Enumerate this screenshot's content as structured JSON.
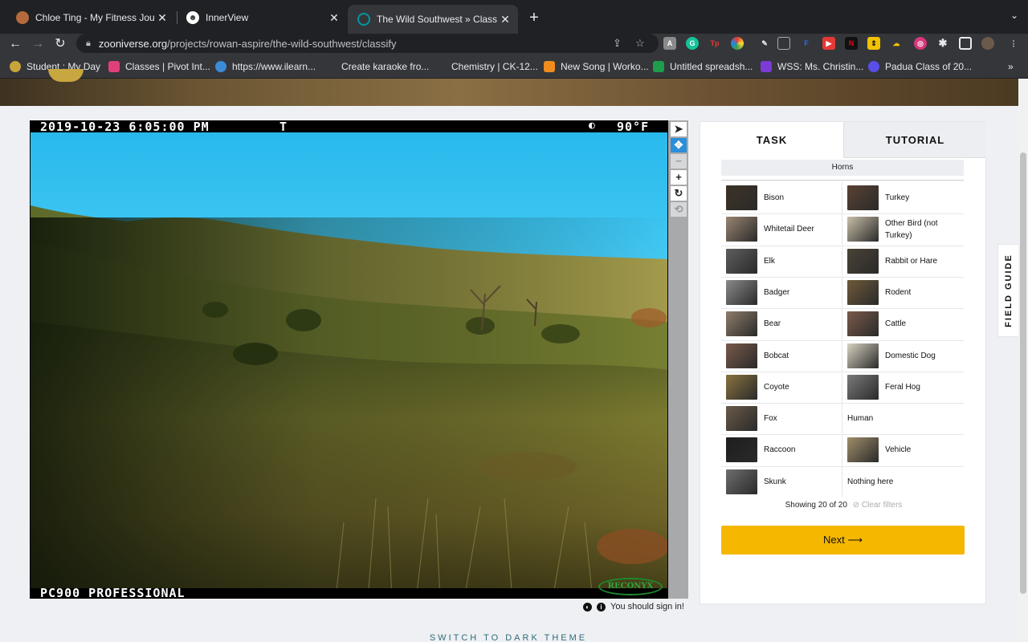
{
  "browser": {
    "tabs": [
      {
        "title": "Chloe Ting - My Fitness Journe",
        "icon": "chloe-ting-favicon",
        "color": "#b56a3c"
      },
      {
        "title": "InnerView",
        "icon": "innerview-favicon",
        "color": "#ffffff"
      },
      {
        "title": "The Wild Southwest » Classify",
        "icon": "zooniverse-favicon",
        "color": "#00979d"
      }
    ],
    "url": {
      "domain": "zooniverse.org",
      "path": "/projects/rowan-aspire/the-wild-southwest/classify"
    },
    "bookmarks": [
      {
        "label": "Student : My Day",
        "color": "#c8a43a"
      },
      {
        "label": "Classes | Pivot Int...",
        "color": "#e0407a"
      },
      {
        "label": "https://www.ilearn...",
        "color": "#3b8bd9"
      },
      {
        "label": "Create karaoke fro...",
        "color": "#35363a"
      },
      {
        "label": "Chemistry | CK-12...",
        "color": "#35363a"
      },
      {
        "label": "New Song | Worko...",
        "color": "#f08c1e"
      },
      {
        "label": "Untitled spreadsh...",
        "color": "#1e9e4a"
      },
      {
        "label": "WSS: Ms. Christin...",
        "color": "#7c3ad6"
      },
      {
        "label": "Padua Class of 20...",
        "color": "#5a4ee8"
      }
    ],
    "more_bookmarks": "»"
  },
  "viewer": {
    "timestamp": "2019-10-23 6:05:00 PM",
    "flag": "T",
    "temperature": "90°F",
    "camera_model": "PC900 PROFESSIONAL",
    "brand": "RECONYX",
    "tools": [
      "pointer-tool",
      "pan-tool",
      "zoom-out-tool",
      "zoom-in-tool",
      "rotate-tool",
      "reset-tool"
    ]
  },
  "footer_notice": "You should sign in!",
  "dark_theme_link": "SWITCH TO DARK THEME",
  "panel": {
    "tabs": {
      "task": "TASK",
      "tutorial": "TUTORIAL"
    },
    "filter_label": "Horns",
    "choices": [
      {
        "label": "Bison",
        "thumb": "#3d3326"
      },
      {
        "label": "Turkey",
        "thumb": "#5a4233"
      },
      {
        "label": "Whitetail Deer",
        "thumb": "#9a8571"
      },
      {
        "label": "Other Bird (not Turkey)",
        "thumb": "#c9bfa8"
      },
      {
        "label": "Elk",
        "thumb": "#5e5e5e"
      },
      {
        "label": "Rabbit or Hare",
        "thumb": "#4a4236"
      },
      {
        "label": "Badger",
        "thumb": "#8a8a8a"
      },
      {
        "label": "Rodent",
        "thumb": "#6e5a3a"
      },
      {
        "label": "Bear",
        "thumb": "#8e7d6a"
      },
      {
        "label": "Cattle",
        "thumb": "#7a5a4a"
      },
      {
        "label": "Bobcat",
        "thumb": "#7a5a4a"
      },
      {
        "label": "Domestic Dog",
        "thumb": "#d9d2c2"
      },
      {
        "label": "Coyote",
        "thumb": "#8a7340"
      },
      {
        "label": "Feral Hog",
        "thumb": "#7a7a7a"
      },
      {
        "label": "Fox",
        "thumb": "#6a5a48"
      },
      {
        "label": "Human",
        "thumb": ""
      },
      {
        "label": "Raccoon",
        "thumb": "#1e1e1e"
      },
      {
        "label": "Vehicle",
        "thumb": "#a08e6a"
      },
      {
        "label": "Skunk",
        "thumb": "#6e6e6e"
      },
      {
        "label": "Nothing here",
        "thumb": ""
      }
    ],
    "showing": "Showing 20 of 20",
    "clear_filters": "Clear filters",
    "next_label": "Next ⟶"
  },
  "field_guide": "FIELD GUIDE"
}
